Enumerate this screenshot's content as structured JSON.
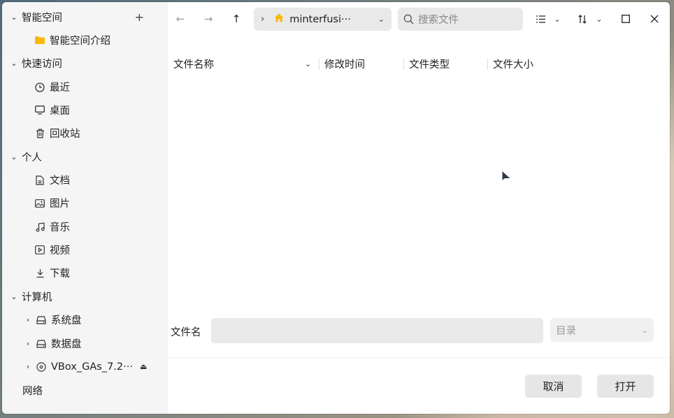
{
  "sidebar": {
    "groups": [
      {
        "label": "智能空间",
        "items": [
          {
            "label": "智能空间介绍",
            "icon": "folder-icon"
          }
        ]
      },
      {
        "label": "快速访问",
        "items": [
          {
            "label": "最近",
            "icon": "clock-icon"
          },
          {
            "label": "桌面",
            "icon": "monitor-icon"
          },
          {
            "label": "回收站",
            "icon": "trash-icon"
          }
        ]
      },
      {
        "label": "个人",
        "items": [
          {
            "label": "文档",
            "icon": "document-icon"
          },
          {
            "label": "图片",
            "icon": "image-icon"
          },
          {
            "label": "音乐",
            "icon": "music-icon"
          },
          {
            "label": "视频",
            "icon": "video-icon"
          },
          {
            "label": "下载",
            "icon": "download-icon"
          }
        ]
      },
      {
        "label": "计算机",
        "items": [
          {
            "label": "系统盘",
            "icon": "drive-icon"
          },
          {
            "label": "数据盘",
            "icon": "drive-icon"
          },
          {
            "label": "VBox_GAs_7.2···",
            "icon": "disc-icon"
          }
        ]
      }
    ],
    "network_label": "网络"
  },
  "toolbar": {
    "path": "minterfusi···",
    "search_placeholder": "搜索文件"
  },
  "columns": {
    "name": "文件名称",
    "modified": "修改时间",
    "type": "文件类型",
    "size": "文件大小"
  },
  "footer": {
    "filename_label": "文件名",
    "filename_value": "",
    "filter_value": "目录",
    "cancel_label": "取消",
    "open_label": "打开"
  },
  "colors": {
    "accent_home": "#f5b900",
    "folder": "#f5b900",
    "sidebar_bg": "#f5f5f5"
  }
}
